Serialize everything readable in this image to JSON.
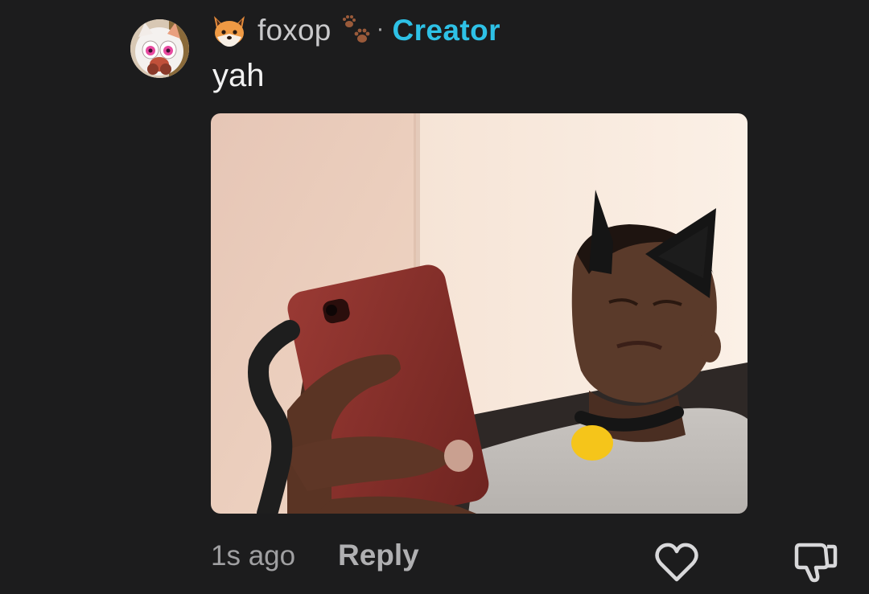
{
  "comment": {
    "author": {
      "username": "foxop",
      "separator": "·",
      "role": "Creator",
      "avatar_icon": "fox-character-avatar",
      "badge_icon": "paw-prints-icon",
      "flair_icon": "fox-face-emoji"
    },
    "text": "yah",
    "attachment": {
      "type": "image",
      "description_icon": "photo-attachment"
    },
    "footer": {
      "timestamp": "1s ago",
      "reply_label": "Reply"
    },
    "actions": {
      "like_icon": "heart-icon",
      "dislike_icon": "thumbs-down-icon"
    }
  },
  "colors": {
    "background": "#1c1c1d",
    "username": "#c9c9cb",
    "role": "#2ec1e6",
    "text": "#f2f2f2",
    "muted": "#a0a0a2"
  }
}
